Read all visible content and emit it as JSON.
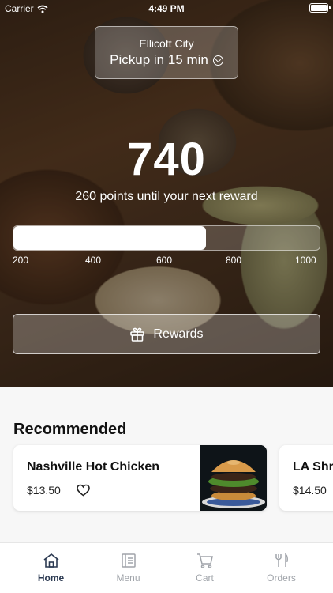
{
  "status_bar": {
    "carrier": "Carrier",
    "time": "4:49 PM"
  },
  "location": {
    "city": "Ellicott City",
    "pickup": "Pickup in 15 min"
  },
  "rewards": {
    "points": "740",
    "subtitle": "260 points until your next reward",
    "progress_fraction": 0.63,
    "ticks": [
      "200",
      "400",
      "600",
      "800",
      "1000"
    ],
    "button_label": "Rewards"
  },
  "recommended": {
    "title": "Recommended",
    "items": [
      {
        "name": "Nashville Hot Chicken",
        "price": "$13.50"
      },
      {
        "name": "LA Shr",
        "price": "$14.50"
      }
    ]
  },
  "tabs": [
    {
      "label": "Home",
      "icon": "home-icon",
      "active": true
    },
    {
      "label": "Menu",
      "icon": "menu-icon",
      "active": false
    },
    {
      "label": "Cart",
      "icon": "cart-icon",
      "active": false
    },
    {
      "label": "Orders",
      "icon": "orders-icon",
      "active": false
    }
  ],
  "colors": {
    "active_tab": "#2c3a52",
    "inactive_tab": "#a0a4aa"
  }
}
